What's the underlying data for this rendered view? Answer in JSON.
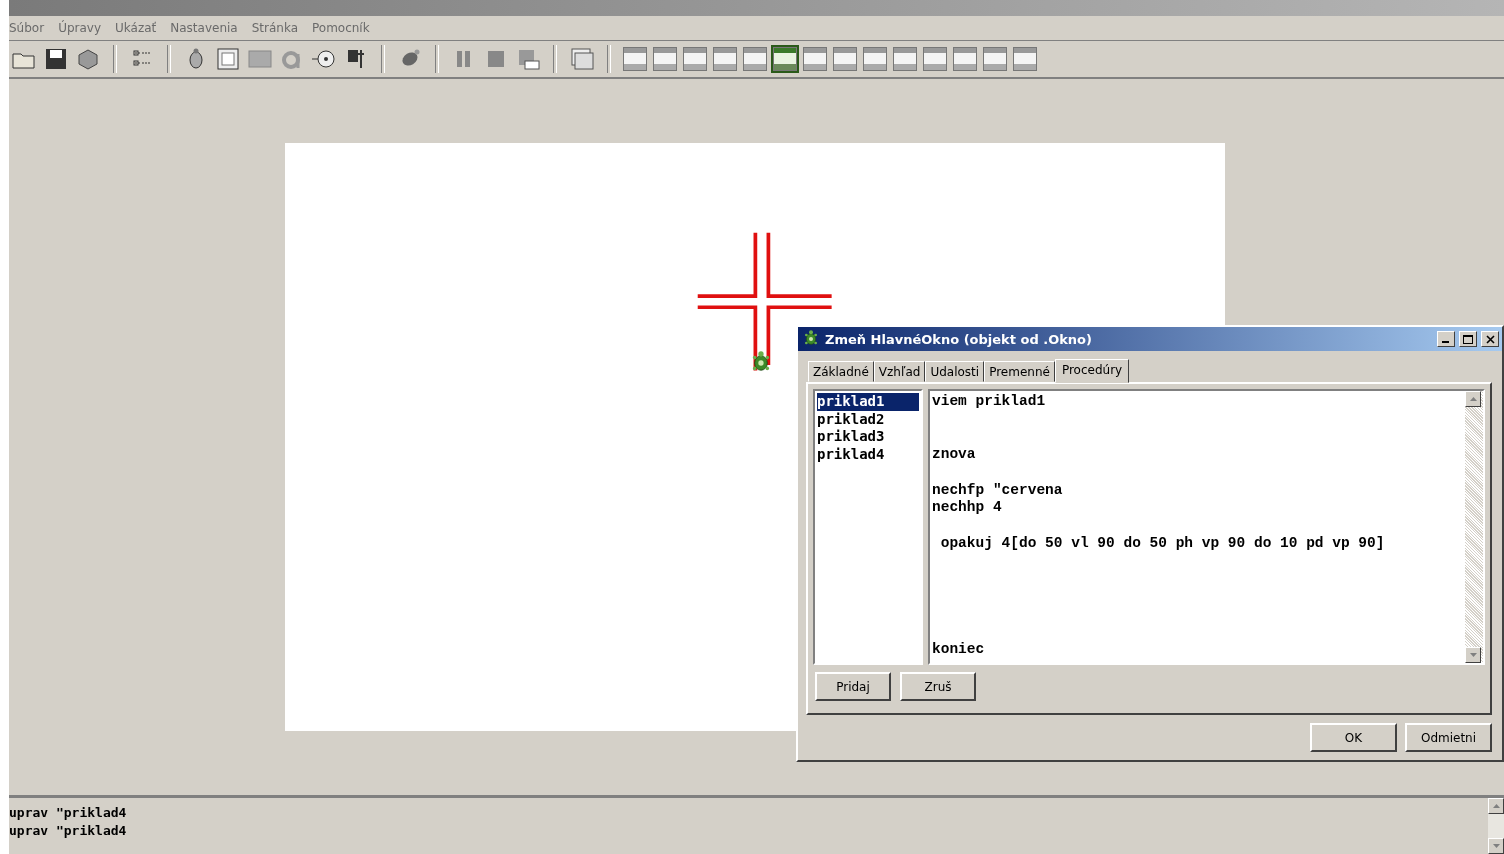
{
  "menu": [
    "Súbor",
    "Úpravy",
    "Ukázať",
    "Nastavenia",
    "Stránka",
    "Pomocník"
  ],
  "pages": [
    {
      "selected": false
    },
    {
      "selected": false
    },
    {
      "selected": false
    },
    {
      "selected": false
    },
    {
      "selected": false
    },
    {
      "selected": true
    },
    {
      "selected": false
    },
    {
      "selected": false
    },
    {
      "selected": false
    },
    {
      "selected": false
    },
    {
      "selected": false
    },
    {
      "selected": false
    },
    {
      "selected": false
    },
    {
      "selected": false
    }
  ],
  "dialog": {
    "title": "Zmeň HlavnéOkno (objekt od .Okno)",
    "tabs": [
      {
        "label": "Základné",
        "selected": false
      },
      {
        "label": "Vzhľad",
        "selected": false
      },
      {
        "label": "Udalosti",
        "selected": false
      },
      {
        "label": "Premenné",
        "selected": false
      },
      {
        "label": "Procedúry",
        "selected": true
      }
    ],
    "procedures": [
      {
        "name": "priklad1",
        "selected": true
      },
      {
        "name": "priklad2",
        "selected": false
      },
      {
        "name": "priklad3",
        "selected": false
      },
      {
        "name": "priklad4",
        "selected": false
      }
    ],
    "code": "viem priklad1\n\n\nznova\n\nnechfp \"cervena\nnechhp 4\n\n opakuj 4[do 50 vl 90 do 50 ph vp 90 do 10 pd vp 90]\n\n\n\n\n\nkoniec",
    "list_buttons": [
      "Pridaj",
      "Zruš"
    ],
    "buttons": [
      "OK",
      "Odmietni"
    ]
  },
  "console": [
    "uprav \"priklad4",
    "uprav \"priklad4"
  ]
}
